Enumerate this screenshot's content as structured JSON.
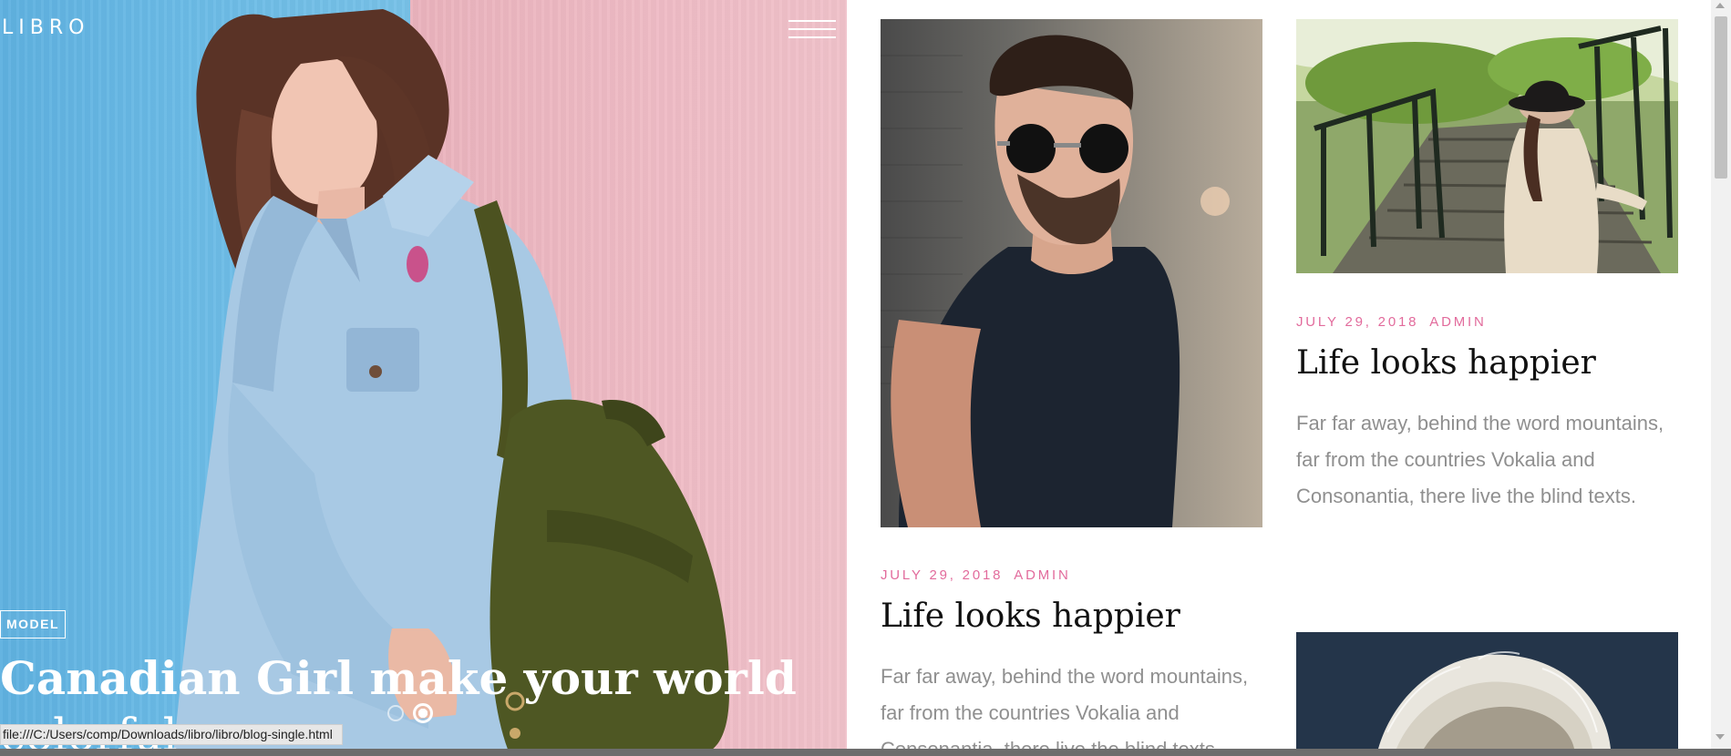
{
  "brand": {
    "logo": "LIBRO"
  },
  "hero": {
    "category": "MODEL",
    "title_line1": "Canadian Girl make your world",
    "title_line2": "colorful",
    "slide_count": 2,
    "active_slide": 2
  },
  "posts": [
    {
      "date": "JULY 29, 2018",
      "author": "ADMIN",
      "title": "Life looks happier",
      "excerpt": "Far far away, behind the word mountains, far from the countries Vokalia and Consonantia, there live the blind texts."
    },
    {
      "date": "JULY 29, 2018",
      "author": "ADMIN",
      "title": "Life looks happier",
      "excerpt": "Far far away, behind the word mountains, far from the countries Vokalia and Consonantia, there live the blind texts."
    }
  ],
  "status_bar": {
    "link": "file:///C:/Users/comp/Downloads/libro/libro/blog-single.html"
  },
  "colors": {
    "accent": "#e26b9c",
    "title": "#111111",
    "excerpt": "#8f8f8f"
  },
  "icons": {
    "menu": "hamburger-icon"
  }
}
